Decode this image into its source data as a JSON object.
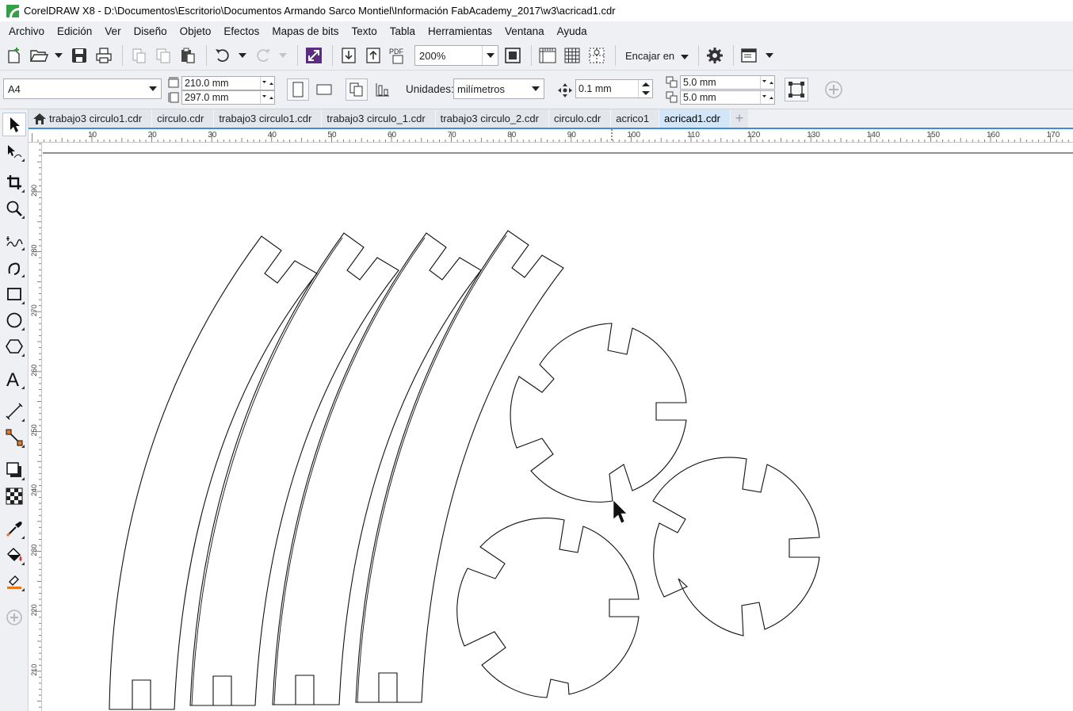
{
  "window": {
    "title": "CorelDRAW X8 - D:\\Documentos\\Escritorio\\Documentos Armando Sarco Montiel\\Información FabAcademy_2017\\w3\\acricad1.cdr"
  },
  "menu": [
    {
      "label": "Archivo"
    },
    {
      "label": "Edición"
    },
    {
      "label": "Ver"
    },
    {
      "label": "Diseño"
    },
    {
      "label": "Objeto"
    },
    {
      "label": "Efectos"
    },
    {
      "label": "Mapas de bits"
    },
    {
      "label": "Texto"
    },
    {
      "label": "Tabla"
    },
    {
      "label": "Herramientas"
    },
    {
      "label": "Ventana"
    },
    {
      "label": "Ayuda"
    }
  ],
  "toolbar": {
    "zoom_value": "200%",
    "snap_label": "Encajar en"
  },
  "propbar": {
    "page_size": "A4",
    "width": "210.0 mm",
    "height": "297.0 mm",
    "units_label": "Unidades:",
    "units_value": "milímetros",
    "nudge": "0.1 mm",
    "dup_x": "5.0 mm",
    "dup_y": "5.0 mm"
  },
  "tabs": [
    {
      "label": "trabajo3 circulo1.cdr",
      "active": false
    },
    {
      "label": "circulo.cdr",
      "active": false
    },
    {
      "label": "trabajo3 circulo1.cdr",
      "active": false
    },
    {
      "label": "trabajo3 circulo_1.cdr",
      "active": false
    },
    {
      "label": "trabajo3 circulo_2.cdr",
      "active": false
    },
    {
      "label": "circulo.cdr",
      "active": false
    },
    {
      "label": "acrico1",
      "active": false
    },
    {
      "label": "acricad1.cdr",
      "active": true
    }
  ],
  "ruler": {
    "h_labels": [
      "10",
      "20",
      "30",
      "40",
      "50",
      "60",
      "70",
      "80",
      "90",
      "100",
      "110",
      "120",
      "130",
      "140",
      "150",
      "160",
      "170"
    ],
    "v_labels": [
      "290",
      "280",
      "270",
      "260",
      "250",
      "240",
      "230",
      "220",
      "210"
    ]
  },
  "icons": {
    "tools": [
      "pick-tool-icon",
      "shape-tool-icon",
      "crop-tool-icon",
      "zoom-tool-icon",
      "freehand-tool-icon",
      "artistic-media-icon",
      "rectangle-tool-icon",
      "ellipse-tool-icon",
      "polygon-tool-icon",
      "text-tool-icon",
      "parallel-dimension-icon",
      "connector-tool-icon",
      "drop-shadow-icon",
      "transparency-icon",
      "eyedropper-icon",
      "interactive-fill-icon",
      "smart-fill-icon",
      "add-tool-icon"
    ]
  },
  "colors": {
    "chrome": "#eef0f4",
    "active_tab": "#d3e6f8",
    "tab_underline": "#3b8fd8",
    "brand_green": "#37a047"
  }
}
